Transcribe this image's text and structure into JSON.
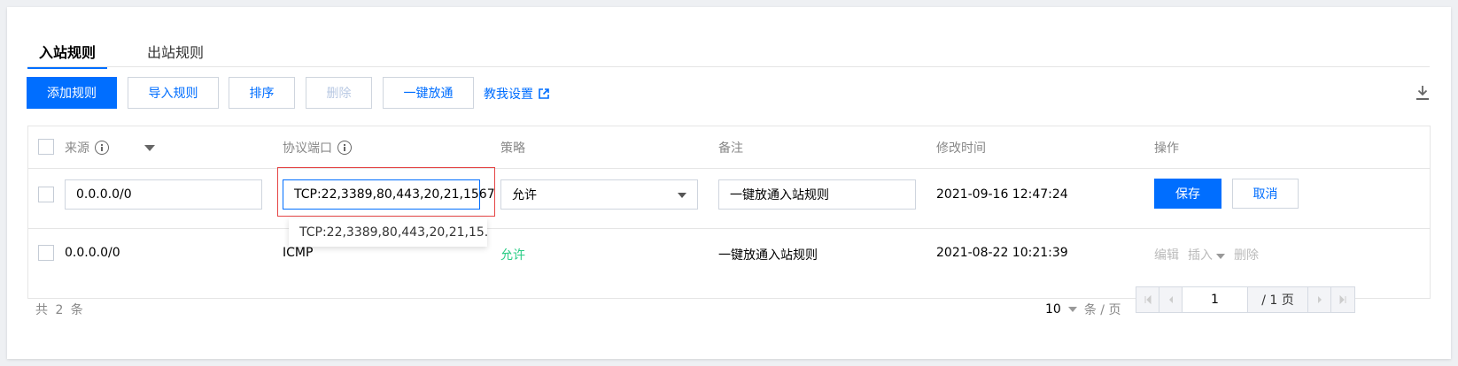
{
  "tabs": [
    {
      "label": "入站规则",
      "active": true
    },
    {
      "label": "出站规则",
      "active": false
    }
  ],
  "toolbar": {
    "add": "添加规则",
    "import": "导入规则",
    "sort": "排序",
    "delete": "删除",
    "open_all": "一键放通",
    "guide": "教我设置"
  },
  "table": {
    "headers": {
      "source": "来源",
      "port": "协议端口",
      "policy": "策略",
      "remark": "备注",
      "modified": "修改时间",
      "actions": "操作"
    },
    "edit_row": {
      "source": "0.0.0.0/0",
      "port": "TCP:22,3389,80,443,20,21,1567",
      "policy": "允许",
      "remark": "一键放通入站规则",
      "modified": "2021-09-16 12:47:24",
      "save": "保存",
      "cancel": "取消",
      "suggestion": "TCP:22,3389,80,443,20,21,15..."
    },
    "rows": [
      {
        "source": "0.0.0.0/0",
        "port": "ICMP",
        "policy": "允许",
        "remark": "一键放通入站规则",
        "modified": "2021-08-22 10:21:39",
        "edit": "编辑",
        "insert": "插入",
        "delete": "删除"
      }
    ]
  },
  "pagination": {
    "total": "共 2 条",
    "page_size": "10",
    "page_size_unit": "条 / 页",
    "current_page": "1",
    "total_pages": "/ 1 页"
  },
  "colors": {
    "primary": "#006eff",
    "allow": "#29cc85",
    "highlight": "#e54545"
  }
}
